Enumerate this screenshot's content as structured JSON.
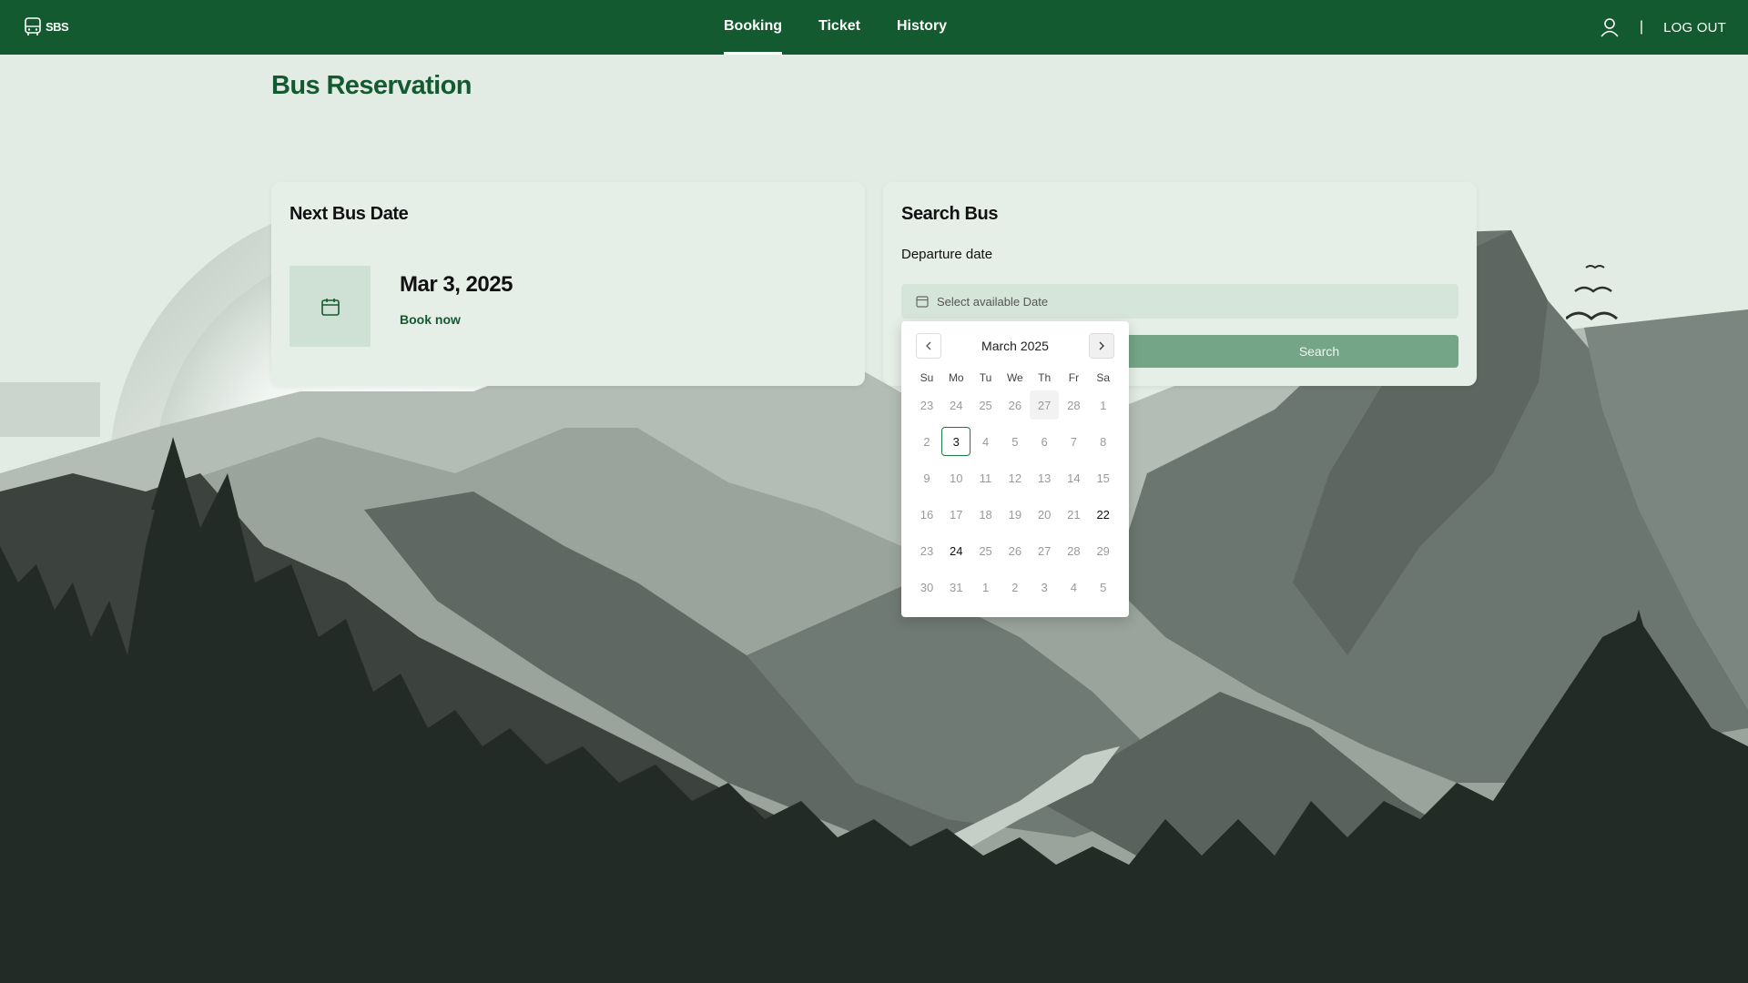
{
  "app": {
    "logo_text": "SBS"
  },
  "nav": {
    "links": [
      {
        "label": "Booking",
        "active": true
      },
      {
        "label": "Ticket",
        "active": false
      },
      {
        "label": "History",
        "active": false
      }
    ],
    "separator": "|",
    "logout_label": "LOG OUT"
  },
  "page": {
    "title": "Bus Reservation"
  },
  "next_bus": {
    "title": "Next Bus Date",
    "date": "Mar 3, 2025",
    "book_label": "Book now"
  },
  "search": {
    "title": "Search Bus",
    "field_label": "Departure date",
    "placeholder": "Select available Date",
    "button_label": "Search"
  },
  "calendar": {
    "month_label": "March 2025",
    "weekdays": [
      "Su",
      "Mo",
      "Tu",
      "We",
      "Th",
      "Fr",
      "Sa"
    ],
    "weeks": [
      [
        "23",
        "24",
        "25",
        "26",
        "27",
        "28",
        "1"
      ],
      [
        "2",
        "3",
        "4",
        "5",
        "6",
        "7",
        "8"
      ],
      [
        "9",
        "10",
        "11",
        "12",
        "13",
        "14",
        "15"
      ],
      [
        "16",
        "17",
        "18",
        "19",
        "20",
        "21",
        "22"
      ],
      [
        "23",
        "24",
        "25",
        "26",
        "27",
        "28",
        "29"
      ],
      [
        "30",
        "31",
        "1",
        "2",
        "3",
        "4",
        "5"
      ]
    ],
    "selected": [
      1,
      1
    ],
    "today": [
      0,
      4
    ],
    "available": [
      [
        1,
        1
      ],
      [
        3,
        6
      ],
      [
        4,
        1
      ]
    ]
  },
  "colors": {
    "primary": "#145a30",
    "background": "#e2ece5",
    "button": "#75a587"
  }
}
